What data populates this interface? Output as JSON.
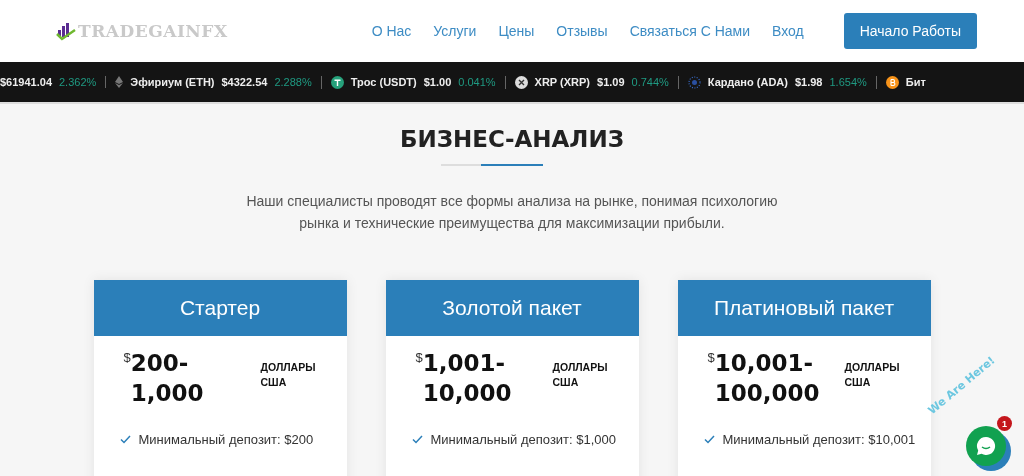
{
  "header": {
    "logo": "TRADEGAINFX",
    "nav": [
      "О Нас",
      "Услуги",
      "Цены",
      "Отзывы",
      "Связаться С Нами",
      "Вход"
    ],
    "cta": "Начало Работы"
  },
  "ticker": [
    {
      "kind": "none",
      "price": "$61941.04",
      "change": "2.362%"
    },
    {
      "kind": "eth",
      "name": "Эфириум (ETH)",
      "price": "$4322.54",
      "change": "2.288%"
    },
    {
      "kind": "usdt",
      "name": "Трос (USDT)",
      "price": "$1.00",
      "change": "0.041%"
    },
    {
      "kind": "xrp",
      "name": "XRP (XRP)",
      "price": "$1.09",
      "change": "0.744%"
    },
    {
      "kind": "ada",
      "name": "Кардано (ADA)",
      "price": "$1.98",
      "change": "1.654%"
    },
    {
      "kind": "btc",
      "name": "Бит"
    }
  ],
  "section": {
    "title": "БИЗНЕС-АНАЛИЗ",
    "text": "Наши специалисты проводят все формы анализа на рынке, понимая психологию рынка и технические преимущества для максимизации прибыли."
  },
  "plans": [
    {
      "title": "Стартер",
      "currency": "$",
      "price_line_1": "200-",
      "price_line_2": "1,000",
      "unit": "ДОЛЛАРЫ США",
      "features": [
        "Минимальный депозит: $200"
      ]
    },
    {
      "title": "Золотой пакет",
      "currency": "$",
      "price_line_1": "1,001-",
      "price_line_2": "10,000",
      "unit": "ДОЛЛАРЫ США",
      "features": [
        "Минимальный депозит: $1,000"
      ]
    },
    {
      "title": "Платиновый пакет",
      "currency": "$",
      "price_line_1": "10,001-",
      "price_line_2": "100,000",
      "unit": "ДОЛЛАРЫ США",
      "features": [
        "Минимальный депозит: $10,001"
      ]
    }
  ],
  "chat": {
    "label": "We Are Here!",
    "badge": "1"
  }
}
